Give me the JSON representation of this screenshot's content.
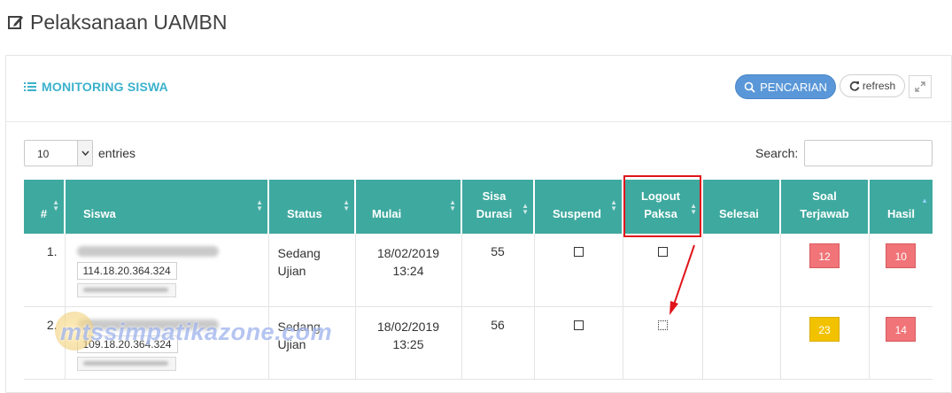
{
  "page": {
    "title": "Pelaksanaan UAMBN"
  },
  "panel": {
    "title": "MONITORING SISWA",
    "search_button": "PENCARIAN",
    "refresh_button": "refresh"
  },
  "table_controls": {
    "entries_value": "10",
    "entries_label": "entries",
    "search_label": "Search:",
    "search_value": ""
  },
  "table": {
    "headers": {
      "no": "#",
      "siswa": "Siswa",
      "status": "Status",
      "mulai": "Mulai",
      "sisa1": "Sisa",
      "sisa2": "Durasi",
      "suspend": "Suspend",
      "logout1": "Logout",
      "logout2": "Paksa",
      "selesai": "Selesai",
      "soal1": "Soal",
      "soal2": "Terjawab",
      "hasil": "Hasil"
    },
    "rows": [
      {
        "no": "1.",
        "ip": "114.18.20.364.324",
        "status1": "Sedang",
        "status2": "Ujian",
        "mulai_date": "18/02/2019",
        "mulai_time": "13:24",
        "sisa_durasi": "55",
        "soal_terjawab": "12",
        "hasil": "10"
      },
      {
        "no": "2.",
        "ip": "109.18.20.364.324",
        "status1": "Sedang",
        "status2": "Ujian",
        "mulai_date": "18/02/2019",
        "mulai_time": "13:25",
        "sisa_durasi": "56",
        "soal_terjawab": "23",
        "hasil": "14"
      }
    ]
  },
  "watermark": "mtssimpatikazone.com",
  "colors": {
    "header_teal": "#3ea99f",
    "title_blue": "#3bb1cc",
    "button_blue": "#5a97d8",
    "badge_red": "#f07478",
    "badge_yellow": "#f2c200",
    "annotation_red": "#e0141b"
  },
  "icons": {
    "title": "edit-icon",
    "panel": "list-icon",
    "search": "search-icon",
    "refresh": "refresh-icon",
    "expand": "expand-icon"
  }
}
